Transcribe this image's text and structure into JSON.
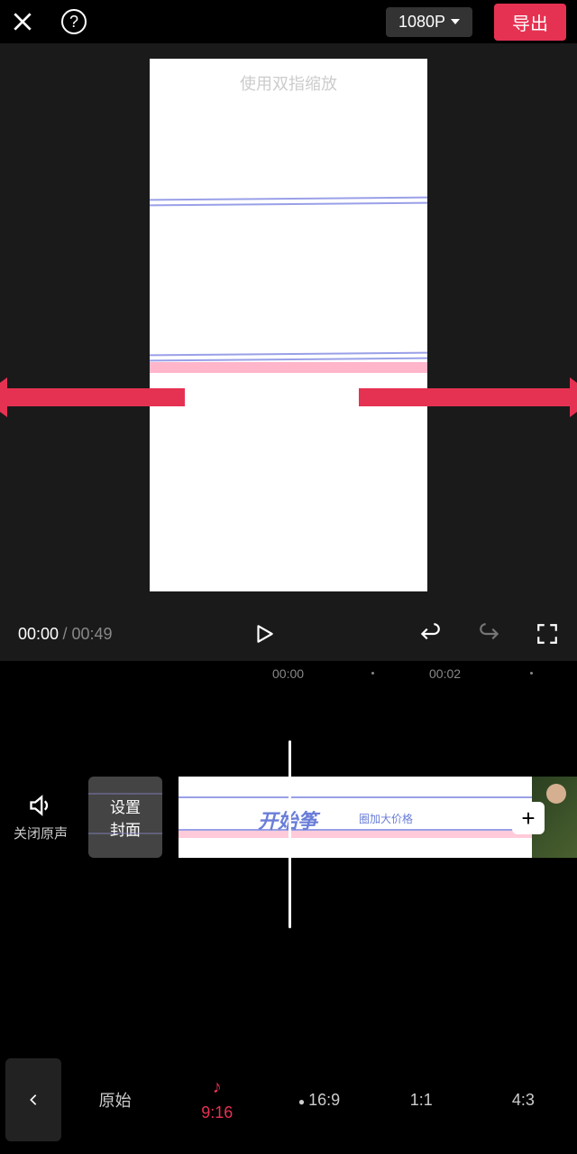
{
  "header": {
    "resolution_label": "1080P",
    "export_label": "导出"
  },
  "preview": {
    "hint": "使用双指缩放"
  },
  "playback": {
    "current_time": "00:00",
    "total_time": "00:49"
  },
  "ruler": {
    "marks": [
      {
        "label": "00:00",
        "pos": 302
      },
      {
        "label": "00:02",
        "pos": 476
      }
    ],
    "dots": [
      412,
      588
    ]
  },
  "timeline": {
    "mute_label": "关闭原声",
    "cover_line1": "设置",
    "cover_line2": "封面",
    "clip_text": "开始筝",
    "clip_small": "圈加大价格",
    "add_label": "+"
  },
  "ratios": {
    "back": "<",
    "items": [
      {
        "key": "original",
        "label": "原始",
        "icon": ""
      },
      {
        "key": "9_16",
        "label": "9:16",
        "icon": "♪",
        "active": true
      },
      {
        "key": "16_9",
        "label": "16:9",
        "icon": "●"
      },
      {
        "key": "1_1",
        "label": "1:1",
        "icon": ""
      },
      {
        "key": "4_3",
        "label": "4:3",
        "icon": ""
      }
    ]
  }
}
